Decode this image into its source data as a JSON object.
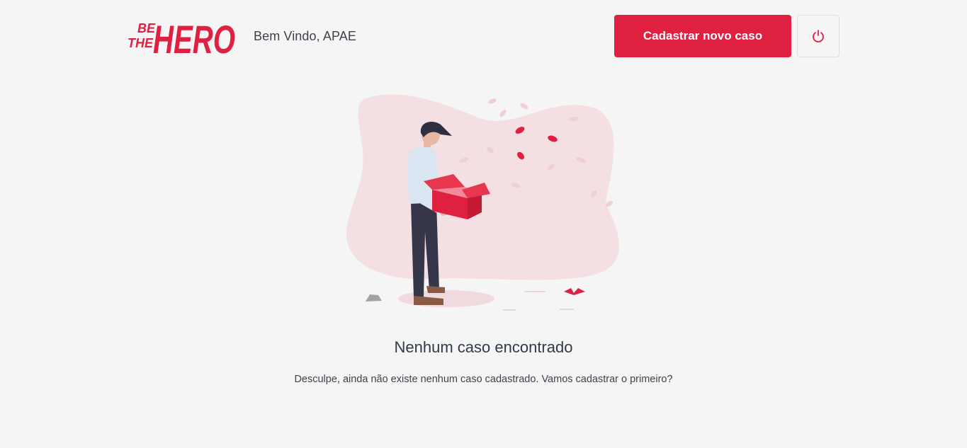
{
  "header": {
    "logo": {
      "line1": "BE",
      "line2": "THE",
      "word": "HERO"
    },
    "welcome": "Bem Vindo, APAE",
    "new_case_label": "Cadastrar novo caso",
    "logout_icon": "power-icon"
  },
  "empty_state": {
    "title": "Nenhum caso encontrado",
    "description": "Desculpe, ainda não existe nenhum caso cadastrado. Vamos cadastrar o primeiro?",
    "illustration": "person-holding-empty-box"
  },
  "colors": {
    "accent": "#e02041",
    "background": "#f5f5f5",
    "text": "#41414d",
    "blob": "#f4dfe2"
  }
}
